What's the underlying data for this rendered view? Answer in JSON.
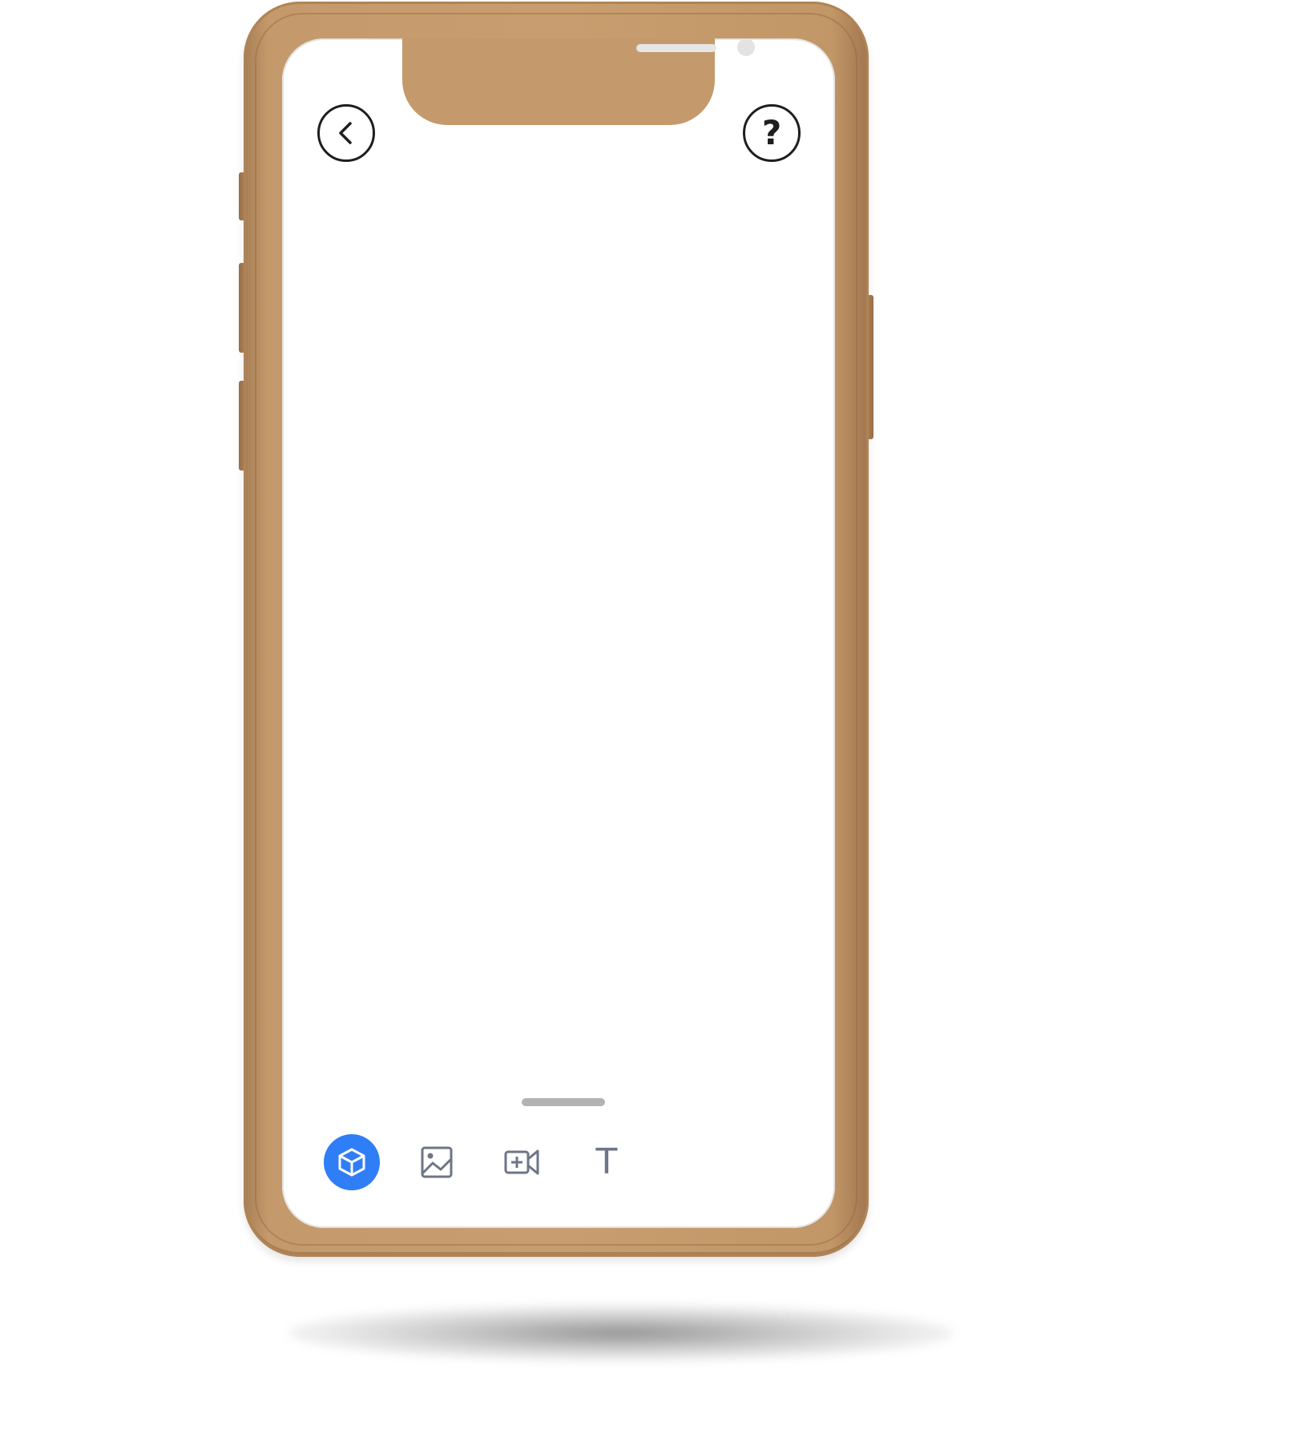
{
  "colors": {
    "device_frame": "#c49a6c",
    "screen_background": "#ffffff",
    "accent": "#2f7ef5",
    "icon_dark": "#1e1e1e",
    "icon_muted": "#6e7585"
  },
  "header": {
    "back_icon": "chevron-left-icon",
    "help_label": "?"
  },
  "toolbar": {
    "active_tool": "3d-object",
    "tools": [
      {
        "icon": "cube-icon",
        "selected": true
      },
      {
        "icon": "image-icon",
        "selected": false
      },
      {
        "icon": "video-add-icon",
        "selected": false
      },
      {
        "icon": "text-icon",
        "label": "T",
        "selected": false
      }
    ]
  }
}
